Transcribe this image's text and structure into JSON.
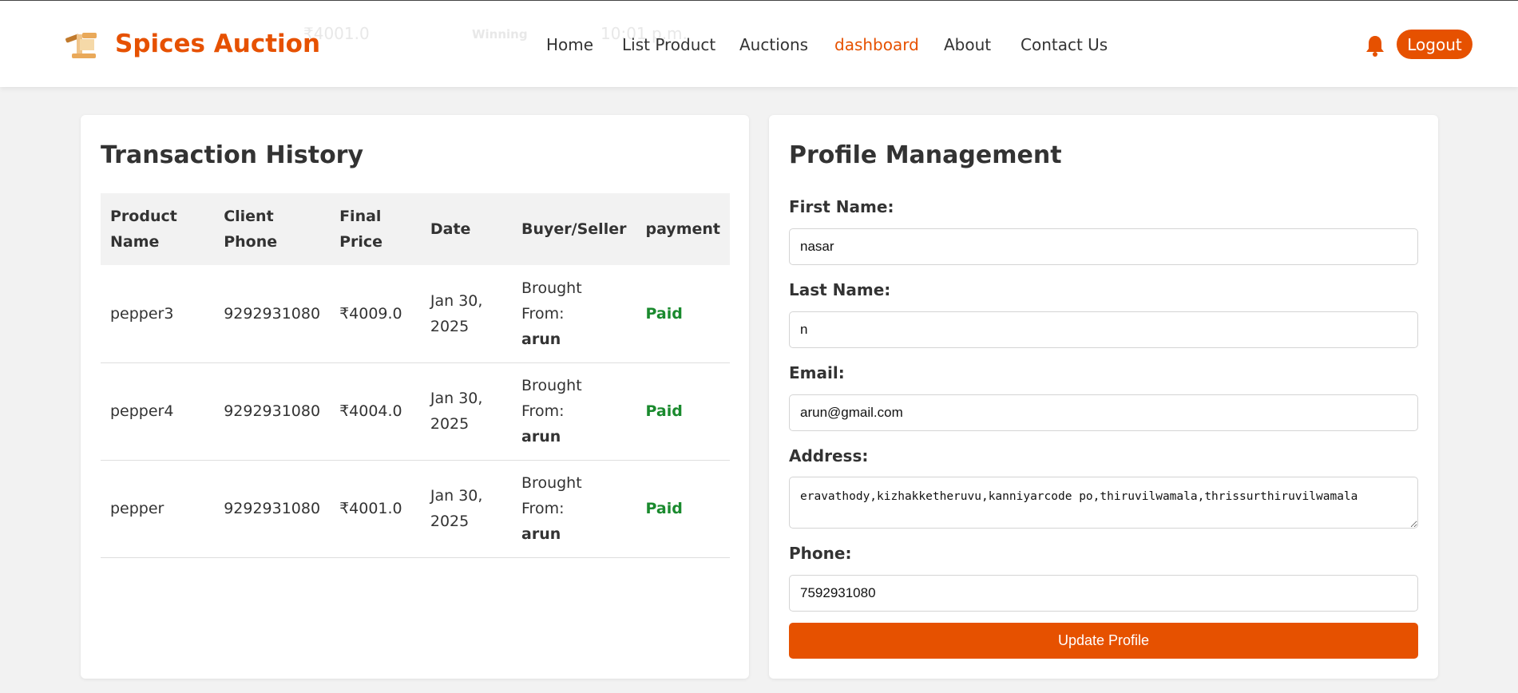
{
  "header": {
    "brand": "Spices Auction",
    "ghost_text": {
      "price": "₹4001.0",
      "status": "Winning",
      "time": "10:01 p.m."
    },
    "nav": [
      {
        "label": "Home",
        "active": false
      },
      {
        "label": "List Product",
        "active": false
      },
      {
        "label": "Auctions",
        "active": false
      },
      {
        "label": "dashboard",
        "active": true
      },
      {
        "label": "About",
        "active": false
      },
      {
        "label": "Contact Us",
        "active": false
      }
    ],
    "notification_icon": "bell-icon",
    "logout_label": "Logout"
  },
  "transactions": {
    "title": "Transaction History",
    "columns": [
      "Product Name",
      "Client Phone",
      "Final Price",
      "Date",
      "Buyer/Seller",
      "payment"
    ],
    "rows": [
      {
        "product": "pepper3",
        "phone": "9292931080",
        "price": "₹4009.0",
        "date": "Jan 30, 2025",
        "relation": "Brought From:",
        "party": "arun",
        "payment": "Paid"
      },
      {
        "product": "pepper4",
        "phone": "9292931080",
        "price": "₹4004.0",
        "date": "Jan 30, 2025",
        "relation": "Brought From:",
        "party": "arun",
        "payment": "Paid"
      },
      {
        "product": "pepper",
        "phone": "9292931080",
        "price": "₹4001.0",
        "date": "Jan 30, 2025",
        "relation": "Brought From:",
        "party": "arun",
        "payment": "Paid"
      }
    ]
  },
  "profile": {
    "title": "Profile Management",
    "first_name_label": "First Name:",
    "first_name": "nasar",
    "last_name_label": "Last Name:",
    "last_name": "n",
    "email_label": "Email:",
    "email": "arun@gmail.com",
    "address_label": "Address:",
    "address": "eravathody,kizhakketheruvu,kanniyarcode po,thiruvilwamala,thrissurthiruvilwamala",
    "phone_label": "Phone:",
    "phone": "7592931080",
    "submit_label": "Update Profile"
  },
  "colors": {
    "accent": "#e65100",
    "paid": "#1a8a2e",
    "background": "#f2f2f2"
  }
}
